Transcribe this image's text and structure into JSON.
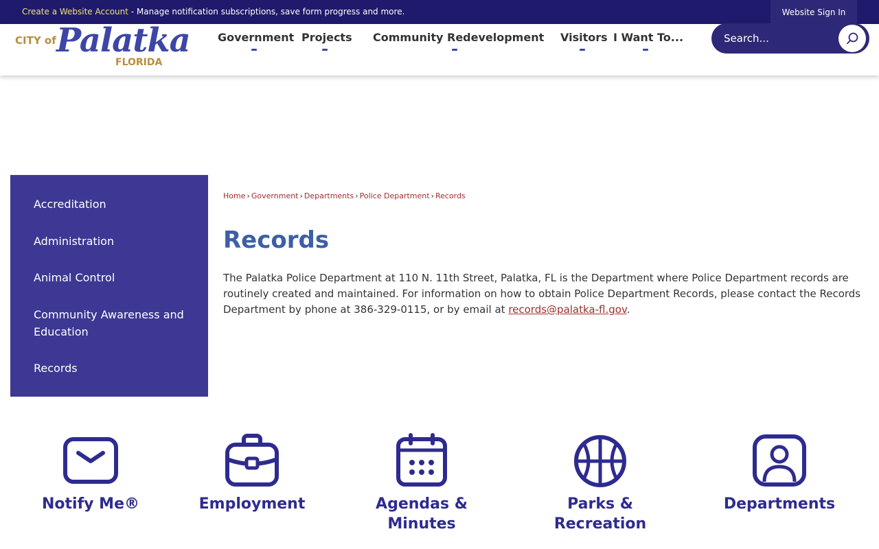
{
  "topbar": {
    "account_link": "Create a Website Account",
    "account_text": " - Manage notification subscriptions, save form progress and more.",
    "signin_label": "Website Sign In"
  },
  "logo": {
    "city_of": "CITY of",
    "name": "Palatka",
    "state": "FLORIDA"
  },
  "nav": [
    "Government",
    "Projects",
    "Community Redevelopment",
    "Visitors",
    "I Want To..."
  ],
  "search": {
    "placeholder": "Search...",
    "icon": "search-icon"
  },
  "sidebar": {
    "items": [
      {
        "label": "Accreditation"
      },
      {
        "label": "Administration"
      },
      {
        "label": "Animal Control"
      },
      {
        "label": "Community Awareness and Education"
      },
      {
        "label": "Records"
      }
    ]
  },
  "breadcrumb": [
    "Home",
    "Government",
    "Departments",
    "Police Department",
    "Records"
  ],
  "page_title": "Records",
  "body": {
    "text": "The Palatka Police Department at 110 N. 11th Street, Palatka, FL is the Department where Police Department records are routinely created and maintained.  For information on how to obtain Police Department Records, please contact the Records Department by phone at 386-329-0115, or by email at ",
    "email": "records@palatka-fl.gov",
    "end": "."
  },
  "quick_links": [
    {
      "label": "Notify Me®",
      "icon": "envelope-icon"
    },
    {
      "label": "Employment",
      "icon": "briefcase-icon"
    },
    {
      "label": "Agendas & Minutes",
      "icon": "calendar-icon"
    },
    {
      "label": "Parks & Recreation",
      "icon": "basketball-icon"
    },
    {
      "label": "Departments",
      "icon": "person-icon"
    }
  ],
  "colors": {
    "topbar": "#1f1a6b",
    "sidebar": "#3d3894",
    "title": "#3d5fa8",
    "link": "#a12d2d",
    "quick_link": "#2e2b8f",
    "gold": "#b88e3c"
  }
}
